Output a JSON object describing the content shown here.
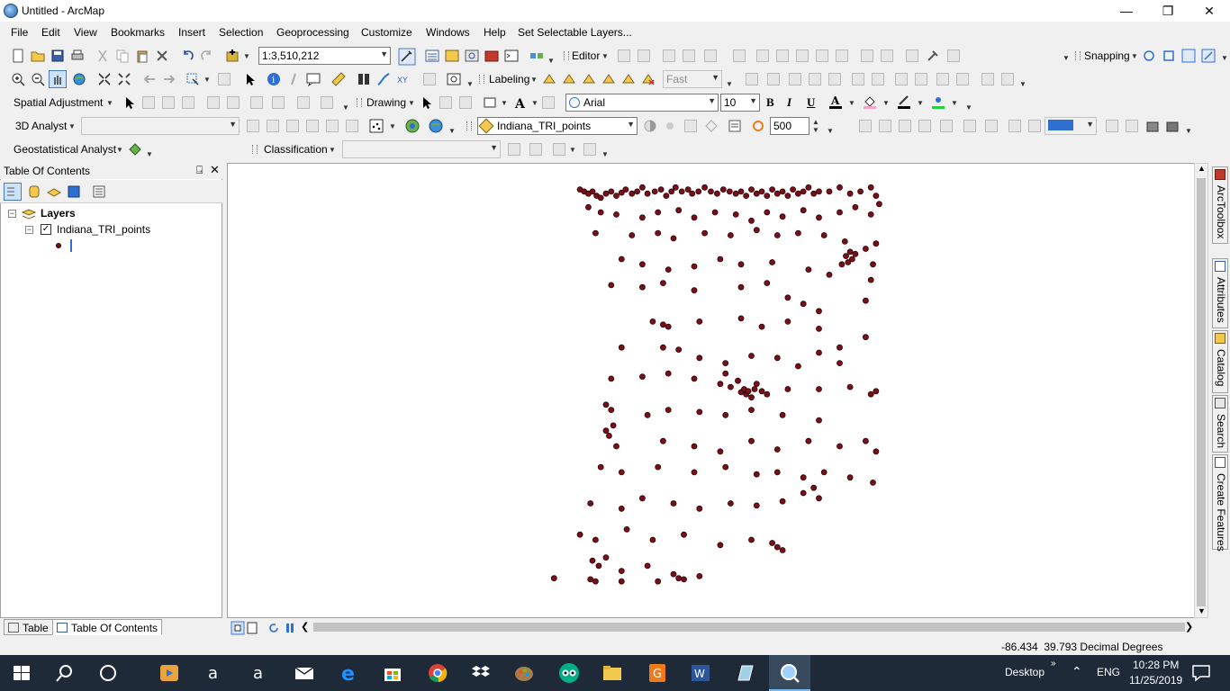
{
  "window": {
    "title": "Untitled - ArcMap"
  },
  "menu": [
    "File",
    "Edit",
    "View",
    "Bookmarks",
    "Insert",
    "Selection",
    "Geoprocessing",
    "Customize",
    "Windows",
    "Help",
    "Set Selectable Layers..."
  ],
  "toolbars": {
    "scale": "1:3,510,212",
    "editor": "Editor",
    "snapping": "Snapping",
    "labeling": "Labeling",
    "label_quality": "Fast",
    "spatial_adjustment": "Spatial Adjustment",
    "drawing": "Drawing",
    "font_name": "Arial",
    "font_size": "10",
    "bold": "B",
    "italic": "I",
    "underline": "U",
    "analyst_3d": "3D Analyst",
    "layer_select": "Indiana_TRI_points",
    "offset_value": "500",
    "geostatistical": "Geostatistical Analyst",
    "classification": "Classification"
  },
  "toc": {
    "title": "Table Of Contents",
    "layers_label": "Layers",
    "layer_name": "Indiana_TRI_points",
    "layer_checked": true,
    "tabs": {
      "table": "Table",
      "toc": "Table Of Contents"
    }
  },
  "right_dock": [
    "ArcToolbox",
    "Attributes",
    "Catalog",
    "Search",
    "Create Features"
  ],
  "status": {
    "x": "-86.434",
    "y": "39.793",
    "units": "Decimal Degrees"
  },
  "taskbar": {
    "desktop_label": "Desktop",
    "language": "ENG",
    "time": "10:28 PM",
    "date": "11/25/2019"
  },
  "colors": {
    "point_fill": "#7a0f1c",
    "point_stroke": "#2a0000",
    "taskbar": "#1f2a38",
    "selection_blue": "#2f6fd2"
  },
  "map": {
    "point_count_hint": "TRI facility points",
    "points": [
      [
        -87.7,
        41.72
      ],
      [
        -87.66,
        41.7
      ],
      [
        -87.62,
        41.68
      ],
      [
        -87.58,
        41.7
      ],
      [
        -87.54,
        41.66
      ],
      [
        -87.5,
        41.64
      ],
      [
        -87.45,
        41.68
      ],
      [
        -87.4,
        41.7
      ],
      [
        -87.35,
        41.66
      ],
      [
        -87.3,
        41.69
      ],
      [
        -87.26,
        41.72
      ],
      [
        -87.2,
        41.68
      ],
      [
        -87.15,
        41.7
      ],
      [
        -87.1,
        41.74
      ],
      [
        -87.05,
        41.68
      ],
      [
        -86.98,
        41.7
      ],
      [
        -86.92,
        41.72
      ],
      [
        -86.87,
        41.66
      ],
      [
        -86.82,
        41.7
      ],
      [
        -86.78,
        41.74
      ],
      [
        -86.72,
        41.7
      ],
      [
        -86.66,
        41.72
      ],
      [
        -86.62,
        41.68
      ],
      [
        -86.56,
        41.7
      ],
      [
        -86.5,
        41.74
      ],
      [
        -86.44,
        41.7
      ],
      [
        -86.38,
        41.68
      ],
      [
        -86.32,
        41.72
      ],
      [
        -86.26,
        41.7
      ],
      [
        -86.2,
        41.68
      ],
      [
        -86.15,
        41.7
      ],
      [
        -86.1,
        41.66
      ],
      [
        -86.05,
        41.72
      ],
      [
        -86.0,
        41.68
      ],
      [
        -85.95,
        41.7
      ],
      [
        -85.9,
        41.66
      ],
      [
        -85.85,
        41.72
      ],
      [
        -85.8,
        41.68
      ],
      [
        -85.75,
        41.7
      ],
      [
        -85.7,
        41.66
      ],
      [
        -85.65,
        41.72
      ],
      [
        -85.6,
        41.68
      ],
      [
        -85.55,
        41.7
      ],
      [
        -85.5,
        41.74
      ],
      [
        -85.45,
        41.68
      ],
      [
        -85.4,
        41.7
      ],
      [
        -85.3,
        41.7
      ],
      [
        -85.2,
        41.74
      ],
      [
        -85.1,
        41.68
      ],
      [
        -85.0,
        41.7
      ],
      [
        -84.9,
        41.74
      ],
      [
        -84.85,
        41.66
      ],
      [
        -87.62,
        41.55
      ],
      [
        -87.5,
        41.5
      ],
      [
        -87.35,
        41.48
      ],
      [
        -87.1,
        41.45
      ],
      [
        -86.95,
        41.5
      ],
      [
        -86.75,
        41.52
      ],
      [
        -86.6,
        41.45
      ],
      [
        -86.4,
        41.5
      ],
      [
        -86.2,
        41.48
      ],
      [
        -86.05,
        41.42
      ],
      [
        -85.9,
        41.5
      ],
      [
        -85.75,
        41.46
      ],
      [
        -85.55,
        41.52
      ],
      [
        -85.4,
        41.45
      ],
      [
        -85.2,
        41.5
      ],
      [
        -85.05,
        41.55
      ],
      [
        -84.9,
        41.48
      ],
      [
        -84.82,
        41.58
      ],
      [
        -87.55,
        41.3
      ],
      [
        -87.2,
        41.28
      ],
      [
        -86.95,
        41.3
      ],
      [
        -86.8,
        41.25
      ],
      [
        -86.5,
        41.3
      ],
      [
        -86.25,
        41.28
      ],
      [
        -86.0,
        41.33
      ],
      [
        -85.8,
        41.28
      ],
      [
        -85.6,
        41.3
      ],
      [
        -85.35,
        41.28
      ],
      [
        -85.15,
        41.22
      ],
      [
        -85.1,
        41.12
      ],
      [
        -85.14,
        41.08
      ],
      [
        -85.08,
        41.05
      ],
      [
        -85.12,
        41.02
      ],
      [
        -85.05,
        41.1
      ],
      [
        -85.18,
        41.0
      ],
      [
        -84.95,
        41.15
      ],
      [
        -84.88,
        41.0
      ],
      [
        -84.85,
        41.2
      ],
      [
        -87.3,
        41.05
      ],
      [
        -87.1,
        41.0
      ],
      [
        -86.85,
        40.95
      ],
      [
        -86.6,
        40.98
      ],
      [
        -86.35,
        41.05
      ],
      [
        -86.15,
        41.0
      ],
      [
        -85.85,
        41.02
      ],
      [
        -85.5,
        40.95
      ],
      [
        -85.3,
        40.9
      ],
      [
        -84.9,
        40.85
      ],
      [
        -87.4,
        40.8
      ],
      [
        -87.1,
        40.78
      ],
      [
        -86.9,
        40.82
      ],
      [
        -86.6,
        40.75
      ],
      [
        -86.15,
        40.78
      ],
      [
        -85.9,
        40.82
      ],
      [
        -85.7,
        40.68
      ],
      [
        -85.55,
        40.62
      ],
      [
        -85.4,
        40.55
      ],
      [
        -84.95,
        40.65
      ],
      [
        -87.0,
        40.45
      ],
      [
        -86.9,
        40.42
      ],
      [
        -86.85,
        40.4
      ],
      [
        -86.55,
        40.45
      ],
      [
        -86.15,
        40.48
      ],
      [
        -85.95,
        40.4
      ],
      [
        -85.7,
        40.45
      ],
      [
        -85.4,
        40.38
      ],
      [
        -85.2,
        40.2
      ],
      [
        -84.95,
        40.3
      ],
      [
        -87.3,
        40.2
      ],
      [
        -86.9,
        40.2
      ],
      [
        -86.75,
        40.18
      ],
      [
        -86.55,
        40.1
      ],
      [
        -86.3,
        40.05
      ],
      [
        -86.05,
        40.12
      ],
      [
        -85.8,
        40.1
      ],
      [
        -85.6,
        40.02
      ],
      [
        -85.4,
        40.15
      ],
      [
        -85.2,
        40.05
      ],
      [
        -87.4,
        39.9
      ],
      [
        -87.1,
        39.92
      ],
      [
        -86.85,
        39.95
      ],
      [
        -86.6,
        39.9
      ],
      [
        -86.35,
        39.85
      ],
      [
        -86.3,
        39.95
      ],
      [
        -86.25,
        39.82
      ],
      [
        -86.18,
        39.88
      ],
      [
        -86.15,
        39.77
      ],
      [
        -86.12,
        39.8
      ],
      [
        -86.1,
        39.75
      ],
      [
        -86.08,
        39.78
      ],
      [
        -86.05,
        39.72
      ],
      [
        -86.02,
        39.8
      ],
      [
        -86.0,
        39.85
      ],
      [
        -85.95,
        39.78
      ],
      [
        -85.9,
        39.75
      ],
      [
        -85.7,
        39.8
      ],
      [
        -85.4,
        39.8
      ],
      [
        -85.1,
        39.82
      ],
      [
        -84.9,
        39.75
      ],
      [
        -84.85,
        39.78
      ],
      [
        -87.45,
        39.65
      ],
      [
        -87.4,
        39.6
      ],
      [
        -87.05,
        39.55
      ],
      [
        -86.85,
        39.6
      ],
      [
        -86.55,
        39.58
      ],
      [
        -86.3,
        39.55
      ],
      [
        -86.05,
        39.6
      ],
      [
        -85.75,
        39.55
      ],
      [
        -85.4,
        39.5
      ],
      [
        -87.45,
        39.4
      ],
      [
        -87.38,
        39.45
      ],
      [
        -87.42,
        39.35
      ],
      [
        -87.35,
        39.25
      ],
      [
        -86.9,
        39.3
      ],
      [
        -86.6,
        39.25
      ],
      [
        -86.35,
        39.2
      ],
      [
        -86.05,
        39.3
      ],
      [
        -85.8,
        39.22
      ],
      [
        -85.5,
        39.3
      ],
      [
        -85.2,
        39.25
      ],
      [
        -84.95,
        39.3
      ],
      [
        -84.85,
        39.2
      ],
      [
        -87.5,
        39.05
      ],
      [
        -87.3,
        39.0
      ],
      [
        -86.95,
        39.05
      ],
      [
        -86.6,
        39.0
      ],
      [
        -86.3,
        39.05
      ],
      [
        -86.0,
        38.98
      ],
      [
        -85.8,
        39.0
      ],
      [
        -85.55,
        38.95
      ],
      [
        -85.35,
        39.0
      ],
      [
        -85.1,
        38.95
      ],
      [
        -84.88,
        38.9
      ],
      [
        -87.6,
        38.7
      ],
      [
        -87.3,
        38.65
      ],
      [
        -87.1,
        38.75
      ],
      [
        -86.8,
        38.7
      ],
      [
        -86.55,
        38.65
      ],
      [
        -86.25,
        38.7
      ],
      [
        -86.0,
        38.68
      ],
      [
        -85.75,
        38.72
      ],
      [
        -85.55,
        38.8
      ],
      [
        -85.45,
        38.85
      ],
      [
        -85.4,
        38.75
      ],
      [
        -87.7,
        38.4
      ],
      [
        -87.55,
        38.35
      ],
      [
        -87.25,
        38.45
      ],
      [
        -87.0,
        38.35
      ],
      [
        -86.7,
        38.4
      ],
      [
        -86.35,
        38.3
      ],
      [
        -86.05,
        38.35
      ],
      [
        -85.85,
        38.32
      ],
      [
        -85.8,
        38.28
      ],
      [
        -85.75,
        38.25
      ],
      [
        -87.58,
        38.15
      ],
      [
        -87.52,
        38.1
      ],
      [
        -87.45,
        38.18
      ],
      [
        -87.3,
        38.05
      ],
      [
        -87.05,
        38.1
      ],
      [
        -86.8,
        38.02
      ],
      [
        -86.55,
        38.0
      ],
      [
        -87.95,
        37.98
      ],
      [
        -87.6,
        37.97
      ],
      [
        -87.55,
        37.95
      ],
      [
        -87.3,
        37.95
      ],
      [
        -86.95,
        37.95
      ],
      [
        -86.75,
        37.98
      ],
      [
        -86.7,
        37.97
      ]
    ]
  }
}
